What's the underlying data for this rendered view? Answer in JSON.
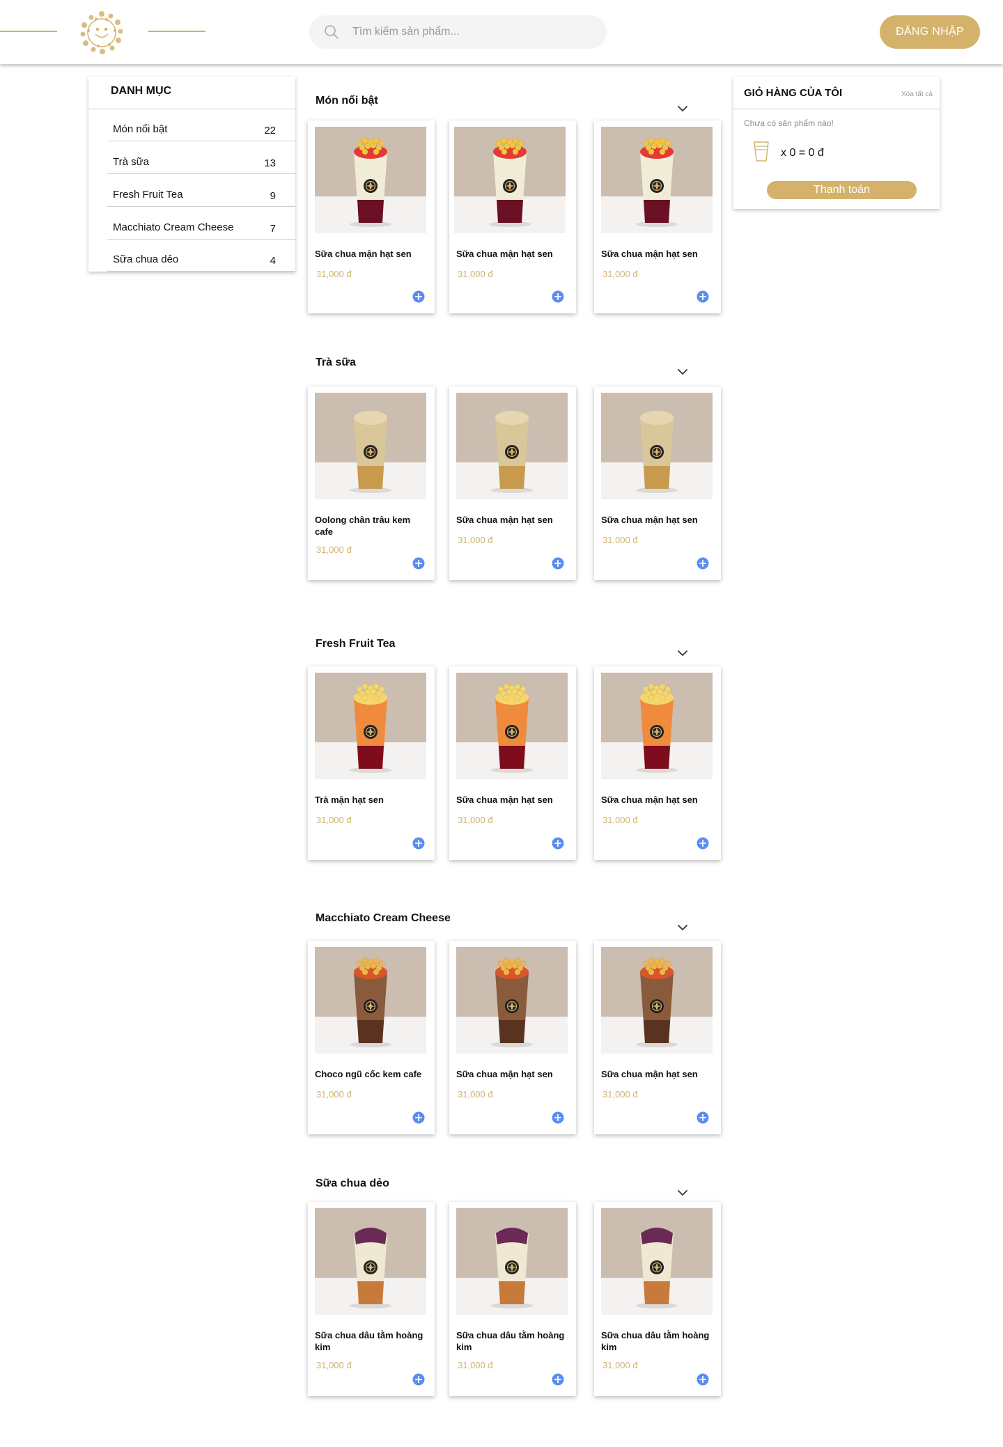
{
  "header": {
    "logo_icon": "floral-wreath-logo",
    "search": {
      "placeholder": "Tìm kiếm sản phẩm...",
      "value": ""
    },
    "login_label": "ĐĂNG NHẬP"
  },
  "categories": {
    "title": "DANH MỤC",
    "items": [
      {
        "label": "Món nổi bật",
        "count": "22"
      },
      {
        "label": "Trà sữa",
        "count": "13"
      },
      {
        "label": "Fresh Fruit Tea",
        "count": "9"
      },
      {
        "label": "Macchiato Cream Cheese",
        "count": "7"
      },
      {
        "label": "Sữa chua dẻo",
        "count": "4"
      }
    ]
  },
  "cart": {
    "title": "GIỎ HÀNG CỦA TÔI",
    "clear_label": "Xóa tất cả",
    "empty_text": "Chưa có sản phẩm nào!",
    "summary": "x 0 = 0 đ",
    "checkout_label": "Thanh toán"
  },
  "colors": {
    "accent": "#d4b26c",
    "add_button": "#5b8def",
    "photo_bg": "#cbbdb0"
  },
  "sections": [
    {
      "title": "Món nổi bật",
      "drink": "fruit-yogurt",
      "products": [
        {
          "name": "Sữa chua mận hạt sen",
          "price": "31,000 đ"
        },
        {
          "name": "Sữa chua mận hạt sen",
          "price": "31,000 đ"
        },
        {
          "name": "Sữa chua mận hạt sen",
          "price": "31,000 đ"
        }
      ]
    },
    {
      "title": "Trà sữa",
      "drink": "milk-tea",
      "products": [
        {
          "name": "Oolong chân trâu kem cafe",
          "price": "31,000 đ"
        },
        {
          "name": "Sữa chua mận hạt sen",
          "price": "31,000 đ"
        },
        {
          "name": "Sữa chua mận hạt sen",
          "price": "31,000 đ"
        }
      ]
    },
    {
      "title": "Fresh Fruit Tea",
      "drink": "fruit-tea",
      "products": [
        {
          "name": "Trà mận hạt sen",
          "price": "31,000 đ"
        },
        {
          "name": "Sữa chua mận hạt sen",
          "price": "31,000 đ"
        },
        {
          "name": "Sữa chua mận hạt sen",
          "price": "31,000 đ"
        }
      ]
    },
    {
      "title": "Macchiato Cream Cheese",
      "drink": "choco-macchiato",
      "products": [
        {
          "name": "Choco ngũ cốc kem cafe",
          "price": "31,000 đ"
        },
        {
          "name": "Sữa chua mận hạt sen",
          "price": "31,000 đ"
        },
        {
          "name": "Sữa chua mận hạt sen",
          "price": "31,000 đ"
        }
      ]
    },
    {
      "title": "Sữa chua dẻo",
      "drink": "berry-yogurt",
      "products": [
        {
          "name": "Sữa chua dâu tằm hoàng kim",
          "price": "31,000 đ"
        },
        {
          "name": "Sữa chua dâu tằm hoàng kim",
          "price": "31,000 đ"
        },
        {
          "name": "Sữa chua dâu tằm hoàng kim",
          "price": "31,000 đ"
        }
      ]
    }
  ]
}
